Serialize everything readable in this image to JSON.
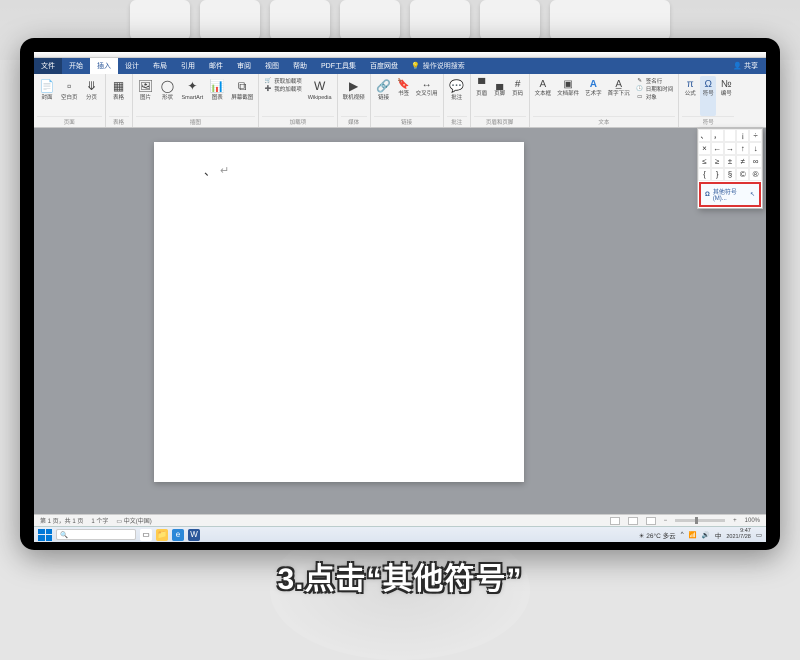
{
  "tabs": {
    "file": "文件",
    "items": [
      "开始",
      "插入",
      "设计",
      "布局",
      "引用",
      "邮件",
      "审阅",
      "视图",
      "帮助",
      "PDF工具集",
      "百度网盘"
    ],
    "active_index": 1,
    "tell_me": "操作说明搜索",
    "share": "共享"
  },
  "ribbon": {
    "groups": {
      "pages": {
        "label": "页面",
        "buttons": {
          "cover": "封面",
          "blank": "空白页",
          "break": "分页"
        }
      },
      "tables": {
        "label": "表格",
        "button": "表格"
      },
      "illustrations": {
        "label": "插图",
        "buttons": {
          "pic": "图片",
          "shapes": "形状",
          "smartart": "SmartArt",
          "chart": "图表",
          "screenshot": "屏幕截图"
        }
      },
      "addins": {
        "label": "加载项",
        "get": "获取加载项",
        "my": "我的加载项",
        "wiki": "Wikipedia"
      },
      "media": {
        "label": "媒体",
        "video": "联机视频"
      },
      "links": {
        "label": "链接",
        "link": "链接",
        "bookmark": "书签",
        "crossref": "交叉引用"
      },
      "comments": {
        "label": "批注",
        "comment": "批注"
      },
      "headerfooter": {
        "label": "页眉和页脚",
        "header": "页眉",
        "footer": "页脚",
        "pagenum": "页码"
      },
      "text": {
        "label": "文本",
        "textbox": "文本框",
        "quickparts": "文档部件",
        "wordart": "艺术字",
        "dropcap": "首字下沉",
        "sig": "签名行",
        "datetime": "日期和时间",
        "object": "对象"
      },
      "symbols": {
        "label": "符号",
        "equation": "公式",
        "symbol": "符号",
        "number": "编号"
      }
    }
  },
  "symbol_panel": {
    "grid": [
      "、",
      "，",
      " ",
      "¡",
      "÷",
      "×",
      "←",
      "→",
      "↑",
      "↓",
      "≤",
      "≥",
      "±",
      "≠",
      "∞",
      "{",
      "}",
      "§",
      "©",
      "®"
    ],
    "more": "其他符号(M)..."
  },
  "statusbar": {
    "page": "第 1 页，共 1 页",
    "words": "1 个字",
    "lang": "中文(中国)",
    "zoom": "100%"
  },
  "taskbar": {
    "weather": "26°C 多云",
    "time": "9:47",
    "date": "2021/7/28"
  },
  "caption": "3.点击“其他符号”"
}
